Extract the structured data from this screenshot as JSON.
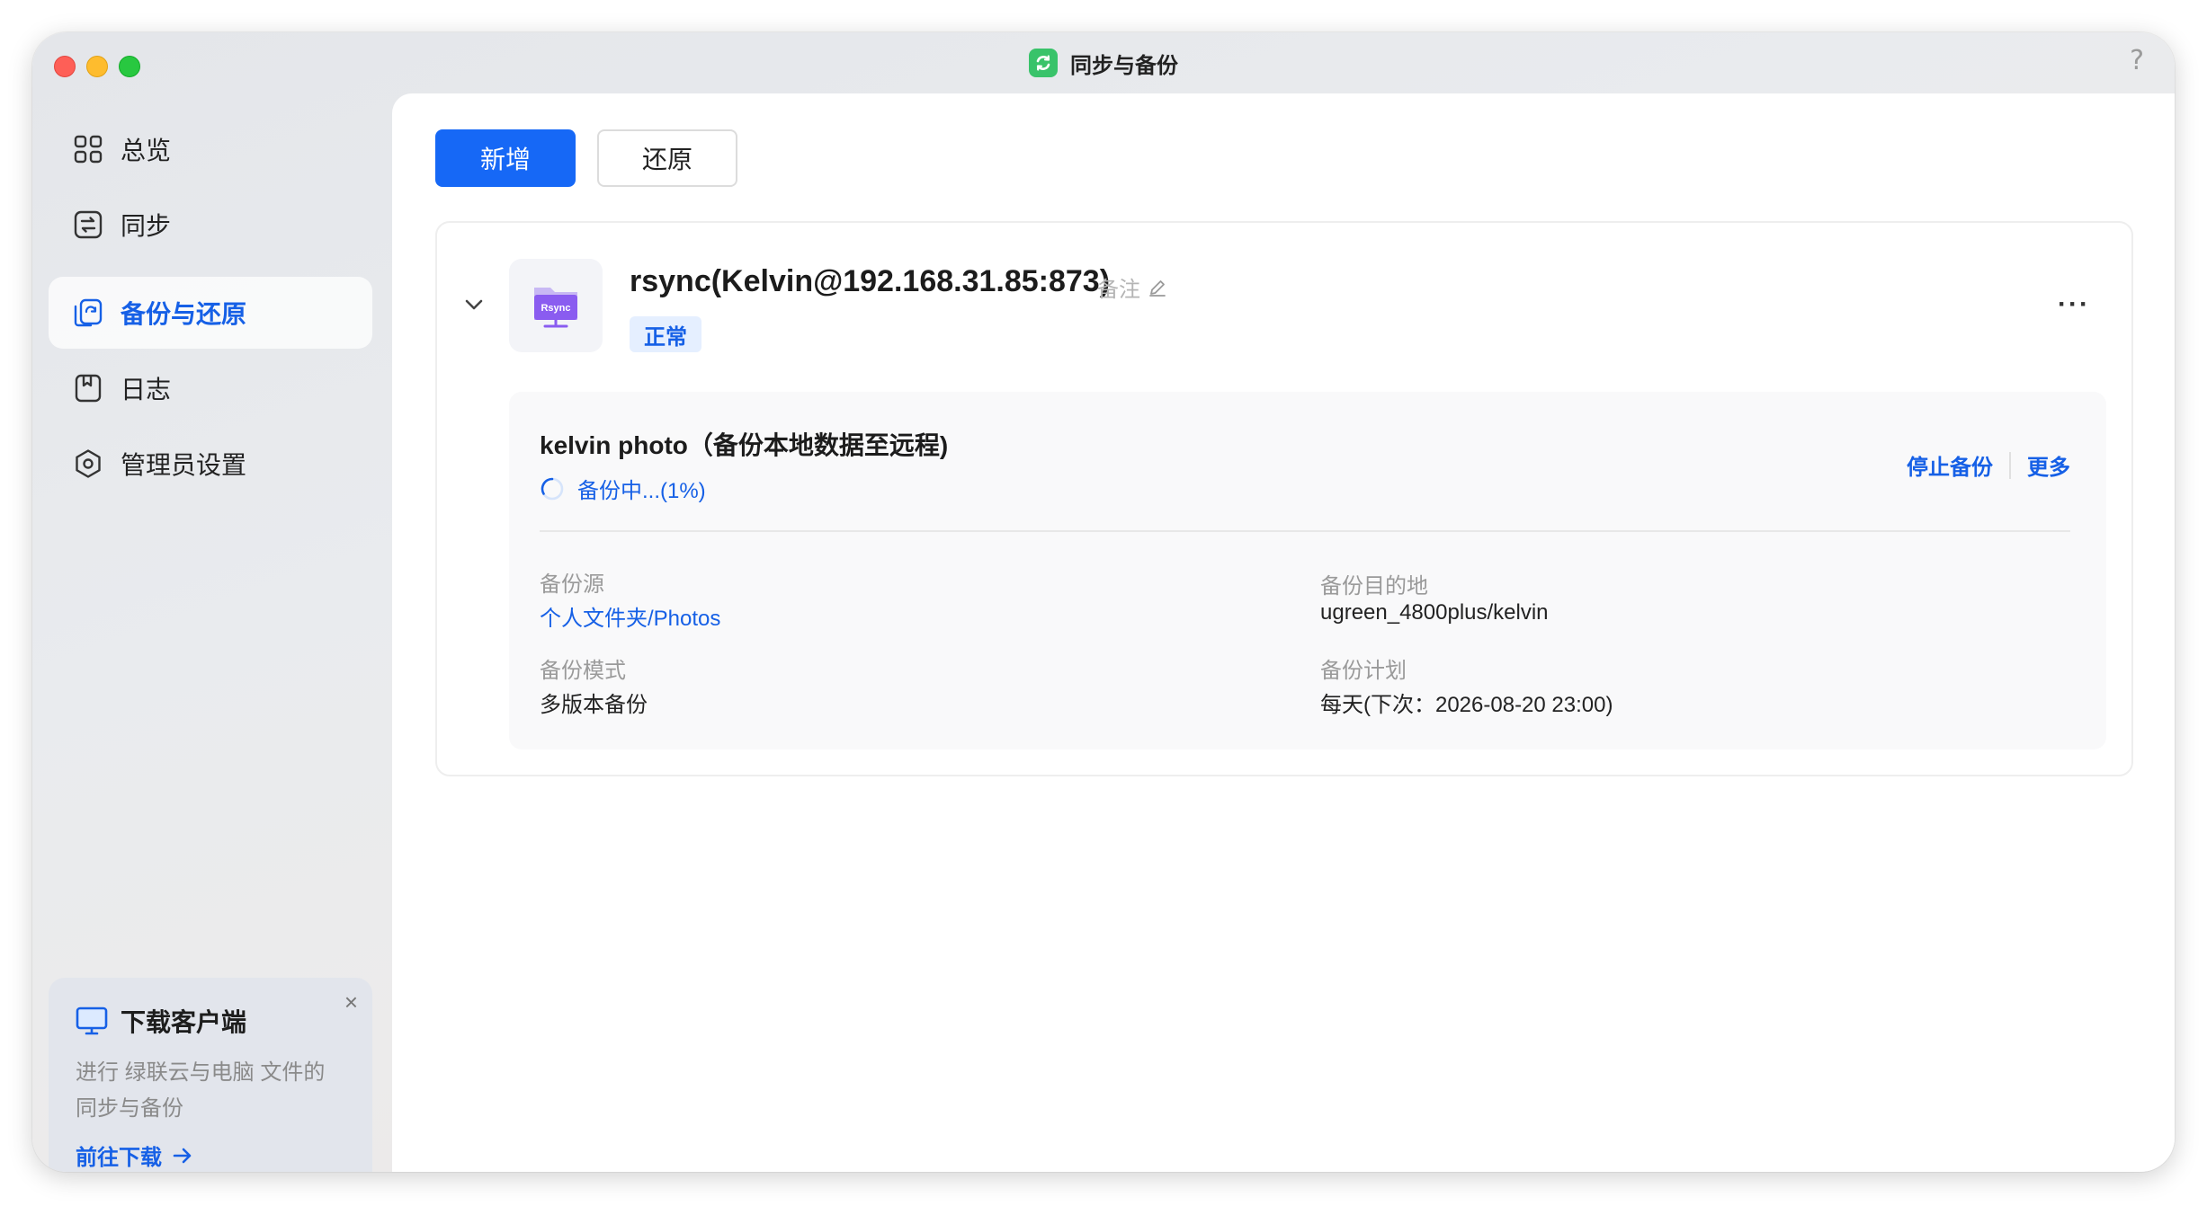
{
  "window": {
    "title": "同步与备份",
    "help_glyph": "?"
  },
  "sidebar": {
    "items": [
      {
        "label": "总览",
        "icon": "grid-icon"
      },
      {
        "label": "同步",
        "icon": "sync-icon"
      },
      {
        "label": "备份与还原",
        "icon": "backup-restore-icon",
        "active": true
      },
      {
        "label": "日志",
        "icon": "log-icon"
      },
      {
        "label": "管理员设置",
        "icon": "settings-icon"
      }
    ]
  },
  "promo": {
    "title": "下载客户端",
    "description": "进行 绿联云与电脑 文件的同步与备份",
    "link": "前往下载",
    "close_glyph": "×"
  },
  "toolbar": {
    "add_label": "新增",
    "restore_label": "还原"
  },
  "task": {
    "title": "rsync(Kelvin@192.168.31.85:873)",
    "note_label": "备注",
    "status": "正常",
    "icon_text": "Rsync",
    "more_glyph": "···",
    "job": {
      "title": "kelvin photo（备份本地数据至远程)",
      "progress_text": "备份中...(1%)",
      "progress_value": 0.01,
      "stop_label": "停止备份",
      "more_label": "更多",
      "source_label": "备份源",
      "source_value": "个人文件夹/Photos",
      "dest_label": "备份目的地",
      "dest_value": "ugreen_4800plus/kelvin",
      "mode_label": "备份模式",
      "mode_value": "多版本备份",
      "schedule_label": "备份计划",
      "schedule_value": "每天(下次：2026-08-20 23:00)"
    }
  },
  "colors": {
    "accent": "#1668f6",
    "link": "#1660e6",
    "badge_bg": "#e5efff",
    "traffic_red": "#fe5f57",
    "traffic_yellow": "#febc2e",
    "traffic_green": "#28c840"
  }
}
